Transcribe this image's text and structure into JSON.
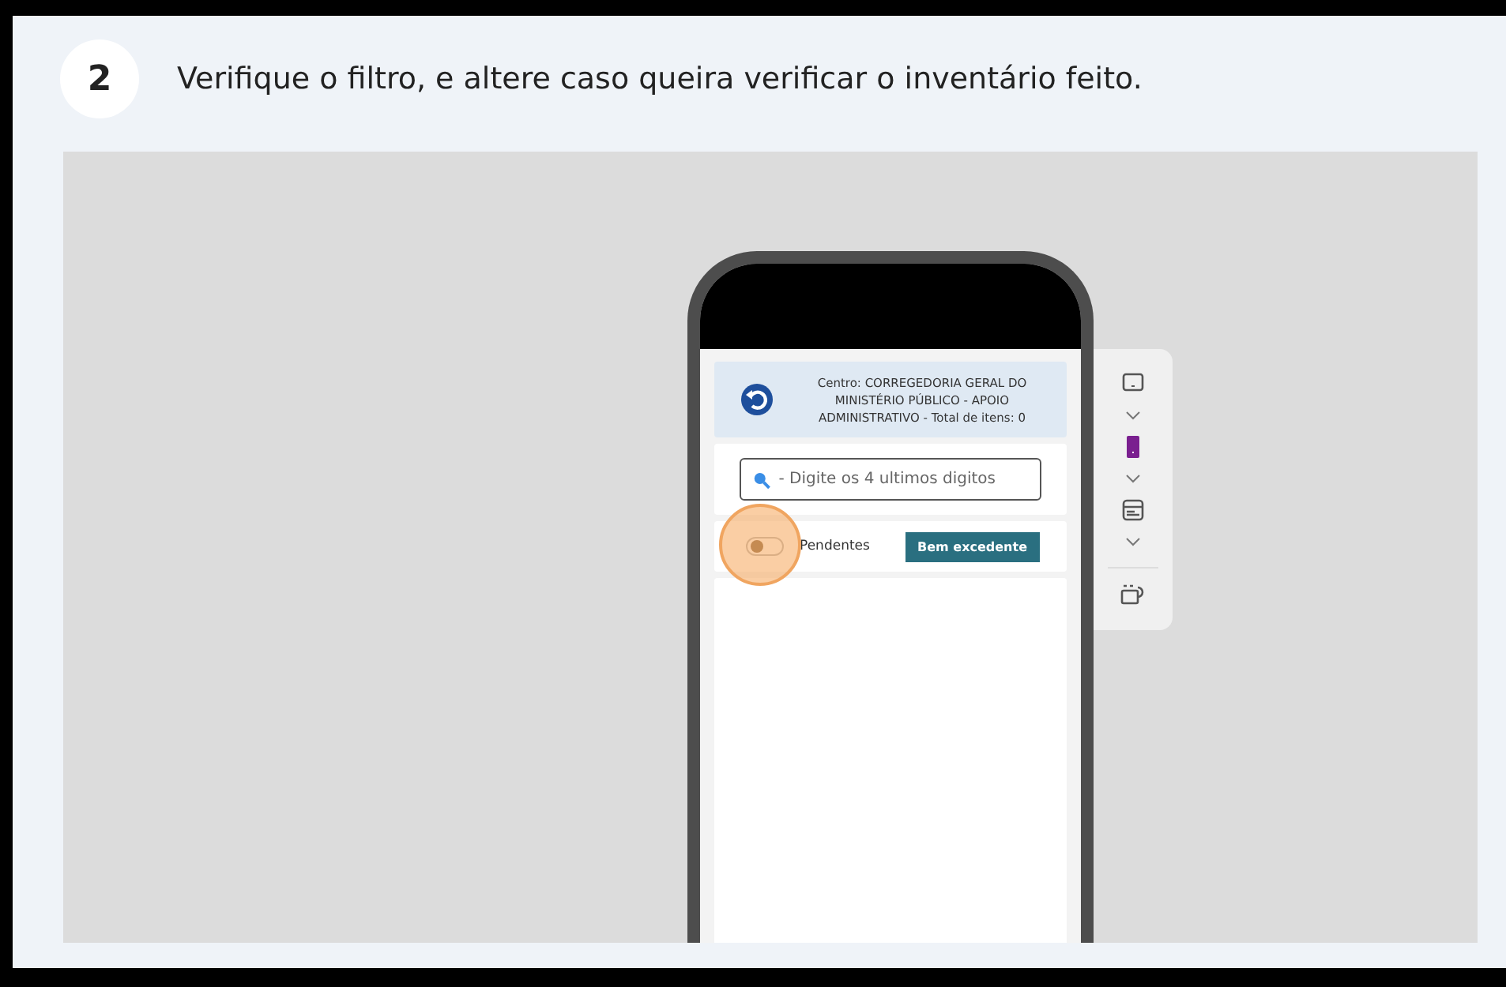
{
  "step": {
    "number": "2",
    "instruction": "Verifique o filtro, e altere caso queira verificar o inventário feito."
  },
  "phone": {
    "header": {
      "text": "Centro: CORREGEDORIA GERAL DO MINISTÉRIO PÚBLICO - APOIO ADMINISTRATIVO - Total de itens: 0"
    },
    "search": {
      "placeholder": "- Digite os 4 ultimos digitos"
    },
    "filter": {
      "label": "Pendentes",
      "on": false,
      "highlighted": true
    },
    "button": "Bem excedente"
  },
  "device_toolbar": {
    "items": [
      {
        "kind": "monitor",
        "selected": false
      },
      {
        "kind": "phone",
        "selected": true
      },
      {
        "kind": "card",
        "selected": false
      },
      {
        "kind": "rotate",
        "selected": false
      }
    ]
  }
}
